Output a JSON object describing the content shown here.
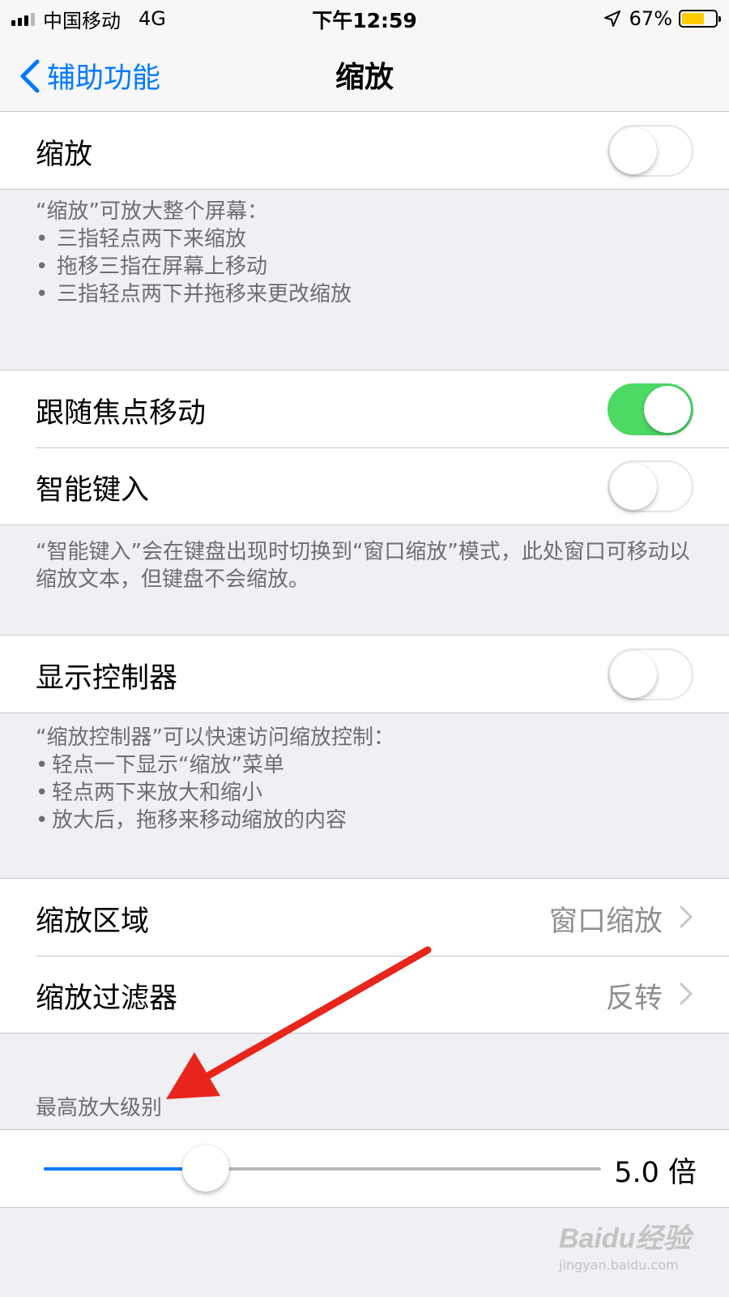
{
  "status_bar": {
    "carrier": "中国移动",
    "network": "4G",
    "time": "下午12:59",
    "battery_percent": "67%",
    "battery_level": 0.67,
    "battery_color": "#ffcc00"
  },
  "nav": {
    "back_label": "辅助功能",
    "title": "缩放"
  },
  "zoom_section": {
    "label": "缩放",
    "toggle_on": false,
    "footer_title": "“缩放”可放大整个屏幕：",
    "footer_bullets": [
      "三指轻点两下来缩放",
      "拖移三指在屏幕上移动",
      "三指轻点两下并拖移来更改缩放"
    ]
  },
  "focus_section": {
    "follow_focus_label": "跟随焦点移动",
    "follow_focus_on": true,
    "smart_typing_label": "智能键入",
    "smart_typing_on": false,
    "footer_text": "“智能键入”会在键盘出现时切换到“窗口缩放”模式，此处窗口可移动以缩放文本，但键盘不会缩放。"
  },
  "controller_section": {
    "label": "显示控制器",
    "toggle_on": false,
    "footer_title": "“缩放控制器”可以快速访问缩放控制：",
    "footer_bullets": [
      "轻点一下显示“缩放”菜单",
      "轻点两下来放大和缩小",
      "放大后，拖移来移动缩放的内容"
    ]
  },
  "region_section": {
    "zoom_region_label": "缩放区域",
    "zoom_region_value": "窗口缩放",
    "zoom_filter_label": "缩放过滤器",
    "zoom_filter_value": "反转"
  },
  "max_zoom_section": {
    "header": "最高放大级别",
    "value_text": "5.0 倍",
    "slider_fraction": 0.29
  },
  "colors": {
    "accent": "#007aff",
    "switch_on": "#4cd964",
    "annotation_arrow": "#e8251b"
  },
  "watermark": {
    "brand": "Baidu经验",
    "url": "jingyan.baidu.com"
  }
}
